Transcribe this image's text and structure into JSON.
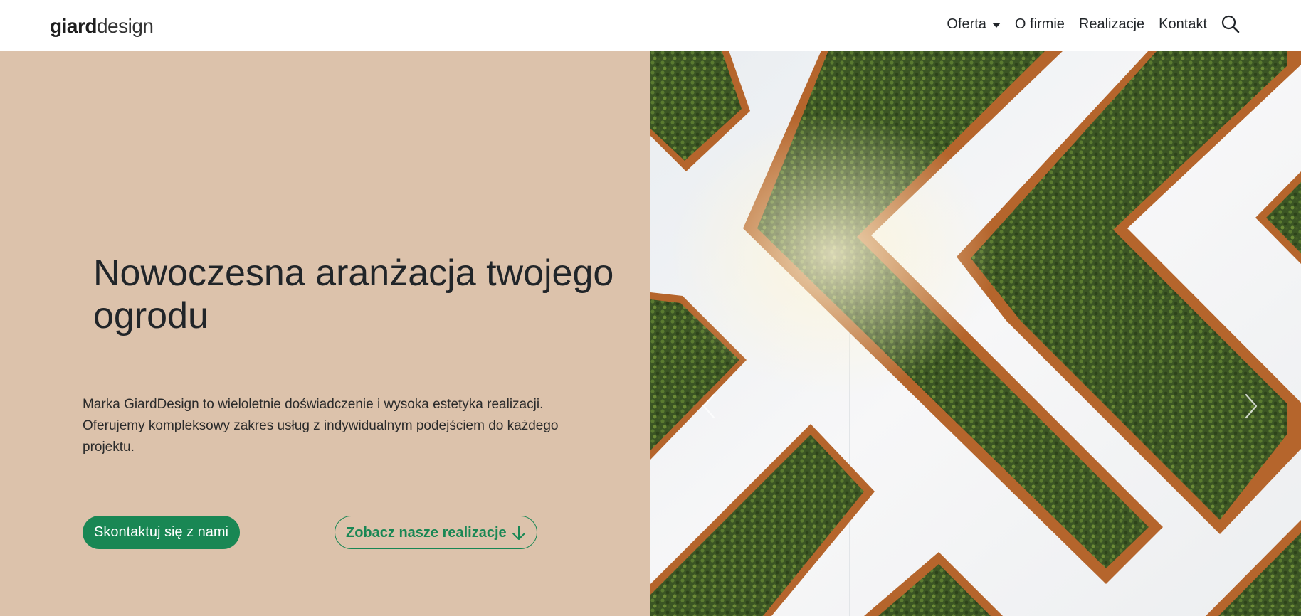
{
  "brand": {
    "logo_bold": "giard",
    "logo_light": "design"
  },
  "nav": {
    "items": [
      {
        "label": "Oferta",
        "has_dropdown": true
      },
      {
        "label": "O firmie"
      },
      {
        "label": "Realizacje"
      },
      {
        "label": "Kontakt"
      }
    ],
    "search_icon": "search-icon"
  },
  "hero": {
    "title": "Nowoczesna aranżacja twojego ogrodu",
    "description": "Marka GiardDesign to wieloletnie doświadczenie i wysoka estetyka realizacji. Oferujemy kompleksowy zakres usług z indywidualnym podejściem do każdego projektu.",
    "primary_button": "Skontaktuj się z nami",
    "secondary_button": "Zobacz nasze realizacje",
    "secondary_icon": "arrow-down-icon"
  },
  "carousel": {
    "prev_icon": "chevron-left-icon",
    "next_icon": "chevron-right-icon"
  },
  "colors": {
    "hero_background": "#dcc2ab",
    "accent_green": "#198754",
    "hedge_green": "#3d5a25",
    "planter_rust": "#b5652c",
    "wall_white": "#f2f3f5"
  }
}
